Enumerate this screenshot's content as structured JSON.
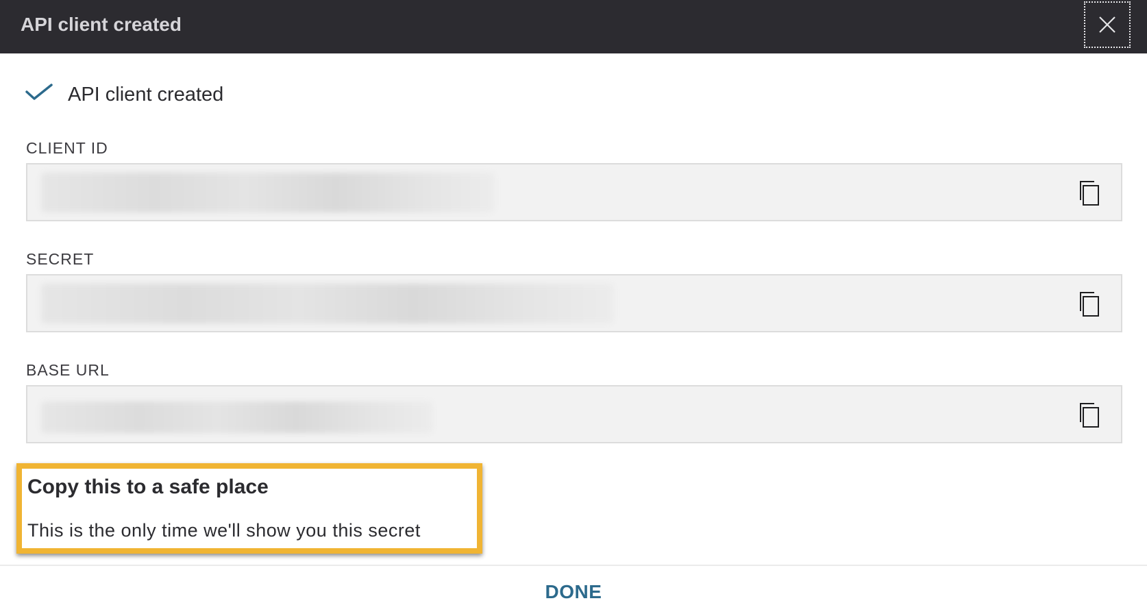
{
  "header": {
    "title": "API client created",
    "close_icon": "close-icon"
  },
  "status": {
    "icon": "check-icon",
    "text": "API client created",
    "accent_color": "#2c6a8c"
  },
  "fields": [
    {
      "label": "CLIENT ID",
      "value": "",
      "copy_icon": "copy-icon",
      "masked": true
    },
    {
      "label": "SECRET",
      "value": "",
      "copy_icon": "copy-icon",
      "masked": true
    },
    {
      "label": "BASE URL",
      "value": "",
      "copy_icon": "copy-icon",
      "masked": true
    }
  ],
  "warning": {
    "title": "Copy this to a safe place",
    "text": "This is the only time we'll show you this secret",
    "highlight_color": "#f0b433"
  },
  "footer": {
    "done_label": "DONE"
  }
}
